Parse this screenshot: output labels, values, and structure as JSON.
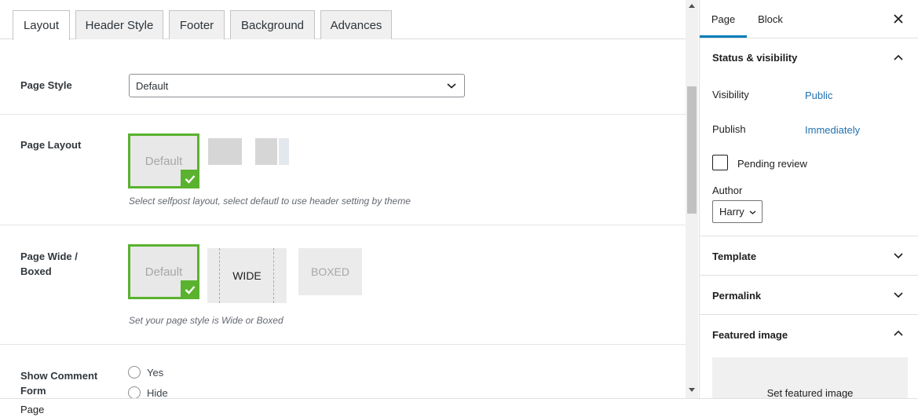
{
  "tabs": [
    "Layout",
    "Header Style",
    "Footer",
    "Background",
    "Advances"
  ],
  "page_style": {
    "label": "Page Style",
    "value": "Default"
  },
  "page_layout": {
    "label": "Page Layout",
    "default_label": "Default",
    "help": "Select selfpost layout, select defautl to use header setting by theme"
  },
  "page_wide": {
    "label": "Page Wide / Boxed",
    "default_label": "Default",
    "wide_label": "WIDE",
    "boxed_label": "BOXED",
    "help": "Set your page style is Wide or Boxed"
  },
  "comment_form": {
    "label": "Show Comment Form",
    "options": [
      "Yes",
      "Hide"
    ]
  },
  "sidebar": {
    "tabs": [
      "Page",
      "Block"
    ],
    "status_visibility": {
      "title": "Status & visibility",
      "visibility_label": "Visibility",
      "visibility_value": "Public",
      "publish_label": "Publish",
      "publish_value": "Immediately",
      "pending_label": "Pending review",
      "author_label": "Author",
      "author_value": "Harry"
    },
    "template_title": "Template",
    "permalink_title": "Permalink",
    "featured_title": "Featured image",
    "featured_button": "Set featured image"
  },
  "status_bar": "Page",
  "colors": {
    "accent_green": "#5ab22e",
    "link_blue": "#2271b1",
    "tab_underline": "#007cba"
  }
}
